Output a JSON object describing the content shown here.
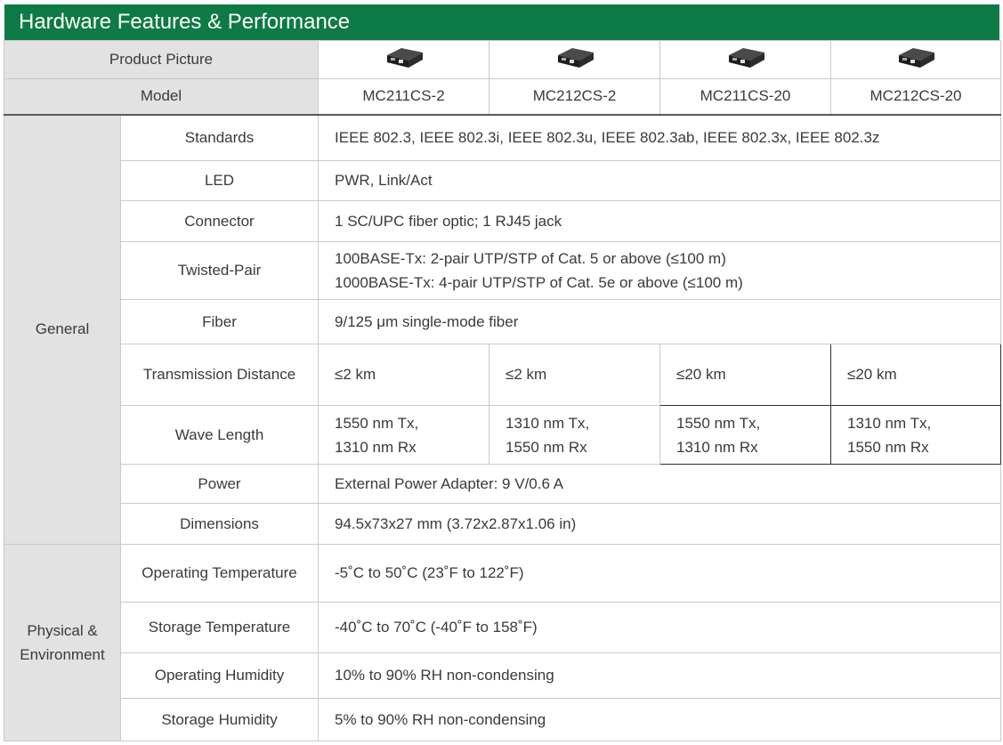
{
  "title": "Hardware Features & Performance",
  "header": {
    "product_picture_label": "Product Picture",
    "model_label": "Model",
    "models": [
      "MC211CS-2",
      "MC212CS-2",
      "MC211CS-20",
      "MC212CS-20"
    ]
  },
  "general": {
    "group_label": "General",
    "standards": {
      "label": "Standards",
      "value": "IEEE 802.3, IEEE 802.3i, IEEE 802.3u, IEEE 802.3ab, IEEE 802.3x, IEEE 802.3z"
    },
    "led": {
      "label": "LED",
      "value": "PWR, Link/Act"
    },
    "connector": {
      "label": "Connector",
      "value": "1 SC/UPC fiber optic; 1 RJ45 jack"
    },
    "twisted_pair": {
      "label": "Twisted-Pair",
      "line1": "100BASE-Tx: 2-pair UTP/STP of Cat. 5 or above (≤100 m)",
      "line2": "1000BASE-Tx: 4-pair UTP/STP of Cat. 5e or above (≤100 m)"
    },
    "fiber": {
      "label": "Fiber",
      "value": "9/125 μm single-mode fiber"
    },
    "transmission_distance": {
      "label": "Transmission Distance",
      "values": [
        "≤2 km",
        "≤2 km",
        "≤20 km",
        "≤20 km"
      ]
    },
    "wave_length": {
      "label": "Wave Length",
      "values": [
        {
          "tx": "1550 nm Tx,",
          "rx": "1310 nm Rx"
        },
        {
          "tx": "1310 nm Tx,",
          "rx": "1550 nm Rx"
        },
        {
          "tx": "1550 nm Tx,",
          "rx": "1310 nm Rx"
        },
        {
          "tx": "1310 nm Tx,",
          "rx": "1550 nm Rx"
        }
      ]
    },
    "power": {
      "label": "Power",
      "value": "External Power Adapter: 9 V/0.6 A"
    },
    "dimensions": {
      "label": "Dimensions",
      "value": "94.5x73x27 mm (3.72x2.87x1.06 in)"
    }
  },
  "physical": {
    "group_line1": "Physical &",
    "group_line2": "Environment",
    "operating_temperature": {
      "label": "Operating Temperature",
      "value": "-5˚C to 50˚C (23˚F to 122˚F)"
    },
    "storage_temperature": {
      "label": "Storage Temperature",
      "value": "-40˚C to 70˚C (-40˚F to 158˚F)"
    },
    "operating_humidity": {
      "label": "Operating Humidity",
      "value": "10% to 90% RH  non-condensing"
    },
    "storage_humidity": {
      "label": "Storage Humidity",
      "value": "5% to 90% RH  non-condensing"
    }
  },
  "colors": {
    "banner": "#0e7a45",
    "header_bg": "#e2e2e2",
    "border": "#c9c9c9",
    "text": "#3a3a3a"
  }
}
